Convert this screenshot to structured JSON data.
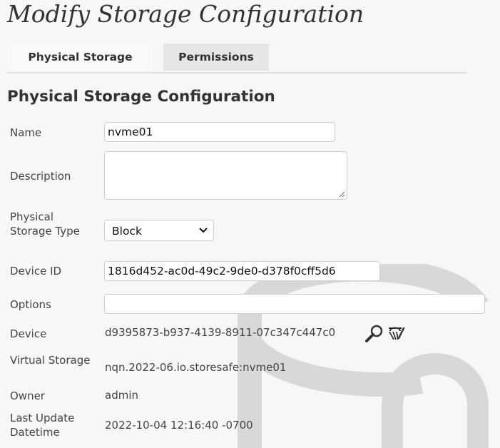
{
  "title": "Modify Storage Configuration",
  "tabs": [
    {
      "label": "Physical Storage",
      "active": true
    },
    {
      "label": "Permissions",
      "active": false
    }
  ],
  "section_title": "Physical Storage Configuration",
  "fields": {
    "name": {
      "label": "Name",
      "value": "nvme01"
    },
    "description": {
      "label": "Description",
      "value": ""
    },
    "type": {
      "label": "Physical Storage Type",
      "value": "Block"
    },
    "device_id": {
      "label": "Device ID",
      "value": "1816d452-ac0d-49c2-9de0-d378f0cff5d6"
    },
    "options": {
      "label": "Options",
      "value": ""
    },
    "device": {
      "label": "Device",
      "value": "d9395873-b937-4139-8911-07c347c447c0"
    },
    "virtual_storage": {
      "label": "Virtual Storage",
      "value": "nqn.2022-06.io.storesafe:nvme01"
    },
    "owner": {
      "label": "Owner",
      "value": "admin"
    },
    "last_update": {
      "label": "Last Update Datetime",
      "value": "2022-10-04 12:16:40 -0700"
    }
  },
  "icons": {
    "device_lookup": "magnifier-icon",
    "device_clear": "clear-brush-icon",
    "watermark": "locked-database-icon"
  },
  "colors": {
    "background": "#f7f7f7",
    "text": "#333333",
    "tab_active": "#f9f9f9",
    "tab_inactive": "#e6e6e6",
    "input_border": "#cfcfcf"
  }
}
